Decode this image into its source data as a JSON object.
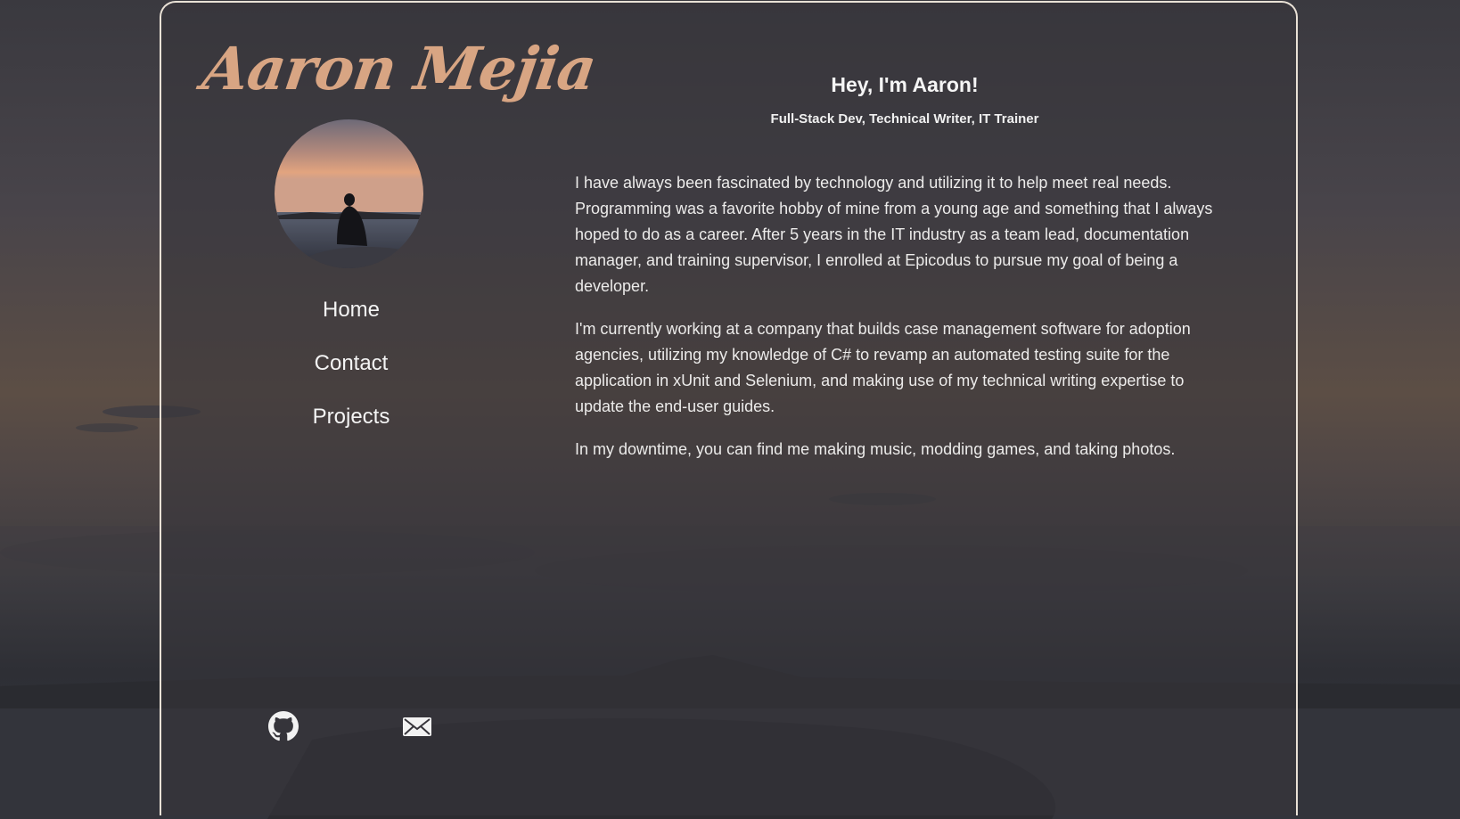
{
  "brand": {
    "name": "Aaron Mejia"
  },
  "nav": {
    "items": [
      {
        "label": "Home"
      },
      {
        "label": "Contact"
      },
      {
        "label": "Projects"
      }
    ]
  },
  "intro": {
    "heading": "Hey, I'm Aaron!",
    "tagline": "Full-Stack Dev, Technical Writer, IT Trainer",
    "paragraphs": [
      "I have always been fascinated by technology and utilizing it to help meet real needs. Programming was a favorite hobby of mine from a young age and something that I always hoped to do as a career. After 5 years in the IT industry as a team lead, documentation manager, and training supervisor, I enrolled at Epicodus to pursue my goal of being a developer.",
      "I'm currently working at a company that builds case management software for adoption agencies, utilizing my knowledge of C# to revamp an automated testing suite for the application in xUnit and Selenium, and making use of my technical writing expertise to update the end-user guides.",
      "In my downtime, you can find me making music, modding games, and taking photos."
    ]
  },
  "social": {
    "icons": [
      "github-icon",
      "mail-icon"
    ]
  },
  "colors": {
    "brand_accent": "#d8a583",
    "card_border": "#e9e1d6",
    "text": "#ededed"
  }
}
